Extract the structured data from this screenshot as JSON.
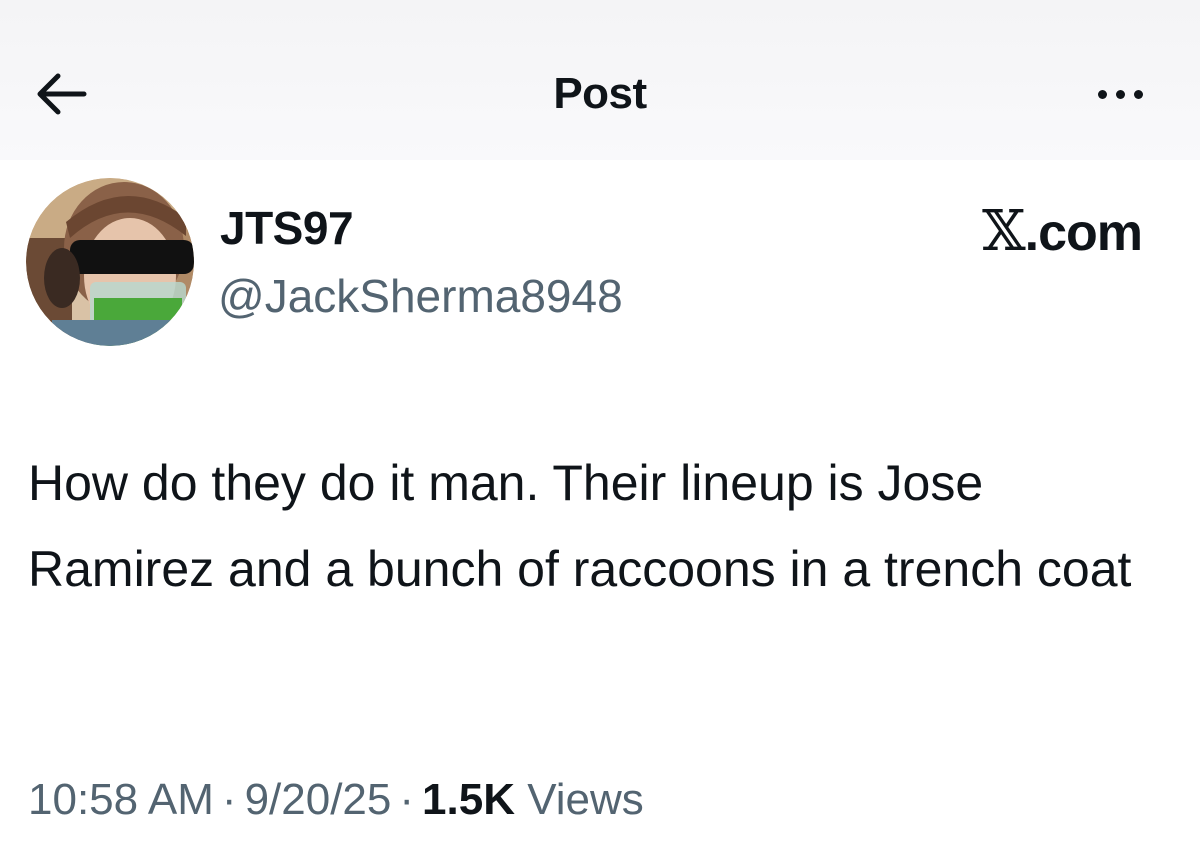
{
  "header": {
    "title": "Post",
    "back_icon": "arrow-left-icon",
    "more_icon": "more-horizontal-icon"
  },
  "author": {
    "display_name": "JTS97",
    "handle": "@JackSherma8948",
    "avatar": "profile-photo"
  },
  "site_badge": {
    "x_glyph": "𝕏",
    "domain": ".com"
  },
  "post": {
    "text": "How do they do it man. Their lineup is Jose Ramirez and a bunch of raccoons in a trench coat"
  },
  "meta": {
    "time": "10:58 AM",
    "date": "9/20/25",
    "separator": "·",
    "views_count": "1.5K",
    "views_label": "Views"
  },
  "colors": {
    "text_primary": "#0f1419",
    "text_secondary": "#536471",
    "header_bg": "#f4f4f6"
  }
}
